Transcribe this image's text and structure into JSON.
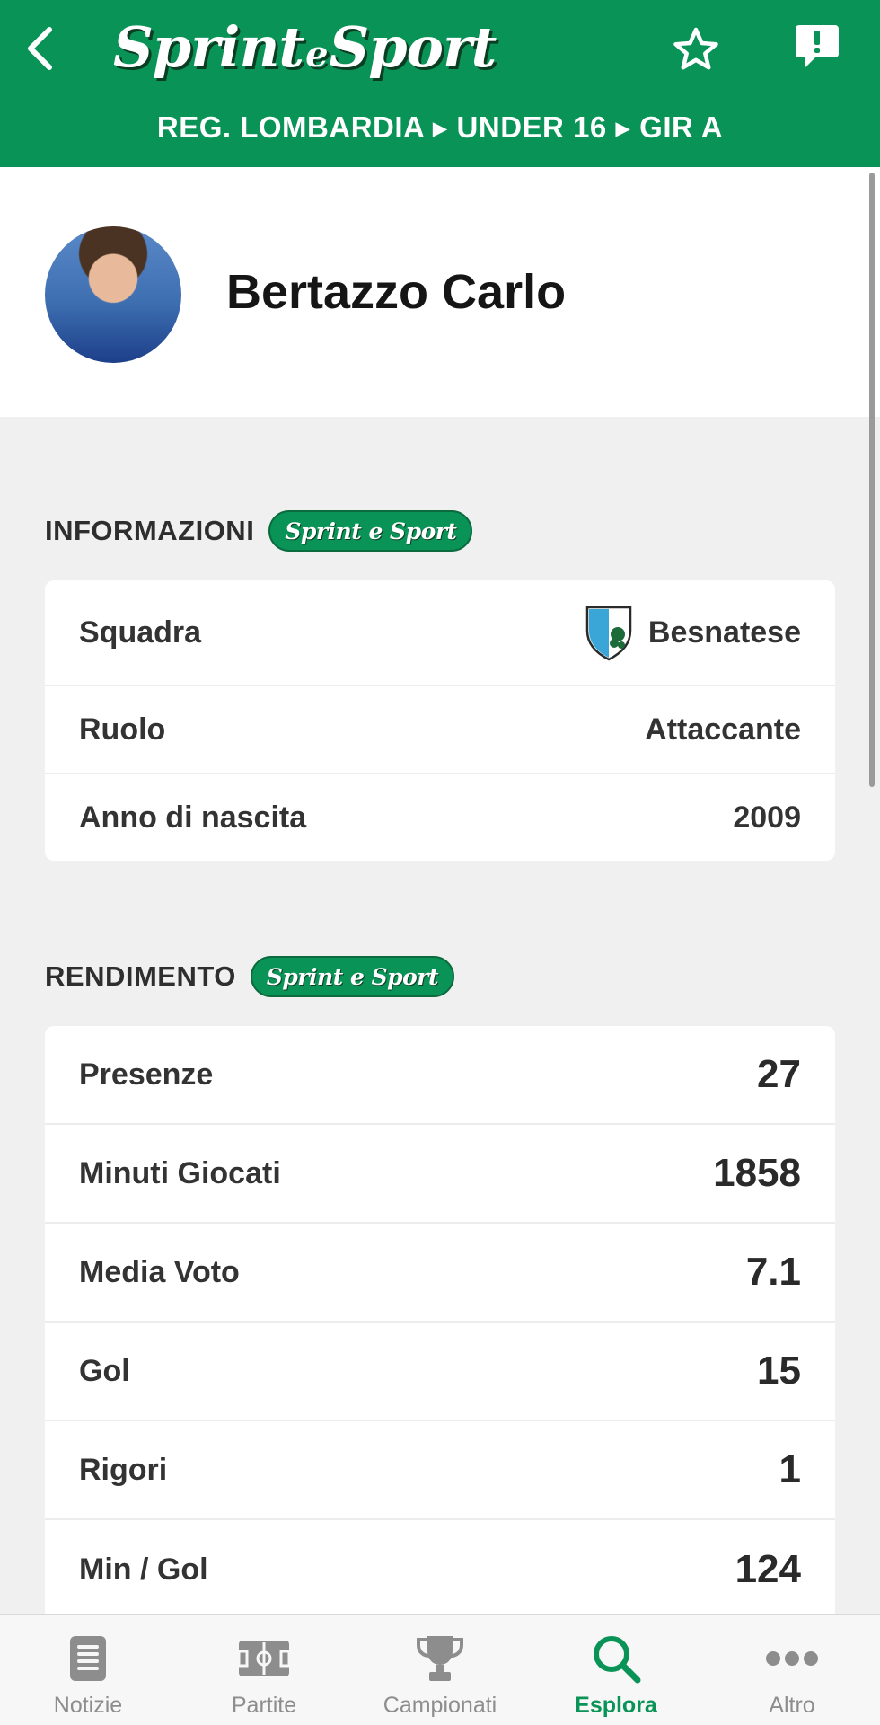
{
  "header": {
    "logo_text_1": "Sprint",
    "logo_text_e": "e",
    "logo_text_2": "Sport",
    "breadcrumb": "REG. LOMBARDIA ▸ UNDER 16 ▸ GIR A"
  },
  "profile": {
    "name": "Bertazzo Carlo"
  },
  "info": {
    "title": "INFORMAZIONI",
    "badge": "Sprint e Sport",
    "rows": [
      {
        "label": "Squadra",
        "value": "Besnatese"
      },
      {
        "label": "Ruolo",
        "value": "Attaccante"
      },
      {
        "label": "Anno di nascita",
        "value": "2009"
      }
    ]
  },
  "performance": {
    "title": "RENDIMENTO",
    "badge": "Sprint e Sport",
    "rows": [
      {
        "label": "Presenze",
        "value": "27"
      },
      {
        "label": "Minuti Giocati",
        "value": "1858"
      },
      {
        "label": "Media Voto",
        "value": "7.1"
      },
      {
        "label": "Gol",
        "value": "15"
      },
      {
        "label": "Rigori",
        "value": "1"
      },
      {
        "label": "Min / Gol",
        "value": "124"
      }
    ]
  },
  "tabs": [
    {
      "label": "Notizie",
      "icon": "news-icon"
    },
    {
      "label": "Partite",
      "icon": "pitch-icon"
    },
    {
      "label": "Campionati",
      "icon": "trophy-icon"
    },
    {
      "label": "Esplora",
      "icon": "search-icon",
      "active": true
    },
    {
      "label": "Altro",
      "icon": "more-icon"
    }
  ],
  "colors": {
    "brand": "#0a9356",
    "tab_inactive": "#8d8d8d"
  }
}
